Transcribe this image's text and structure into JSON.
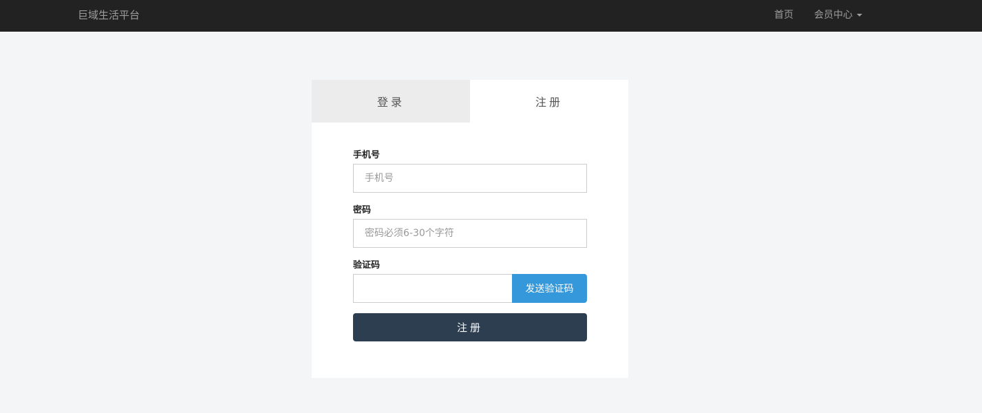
{
  "navbar": {
    "brand": "巨域生活平台",
    "links": [
      {
        "label": "首页"
      },
      {
        "label": "会员中心"
      }
    ]
  },
  "tabs": [
    {
      "label": "登录",
      "active": false
    },
    {
      "label": "注册",
      "active": true
    }
  ],
  "form": {
    "phone": {
      "label": "手机号",
      "placeholder": "手机号",
      "value": ""
    },
    "password": {
      "label": "密码",
      "placeholder": "密码必须6-30个字符",
      "value": ""
    },
    "code": {
      "label": "验证码",
      "placeholder": "",
      "value": "",
      "send_label": "发送验证码"
    },
    "submit_label": "注册"
  },
  "colors": {
    "navbar_bg": "#222222",
    "send_button": "#3498db",
    "submit_button": "#2c3e50",
    "page_bg": "#f4f5f7"
  }
}
